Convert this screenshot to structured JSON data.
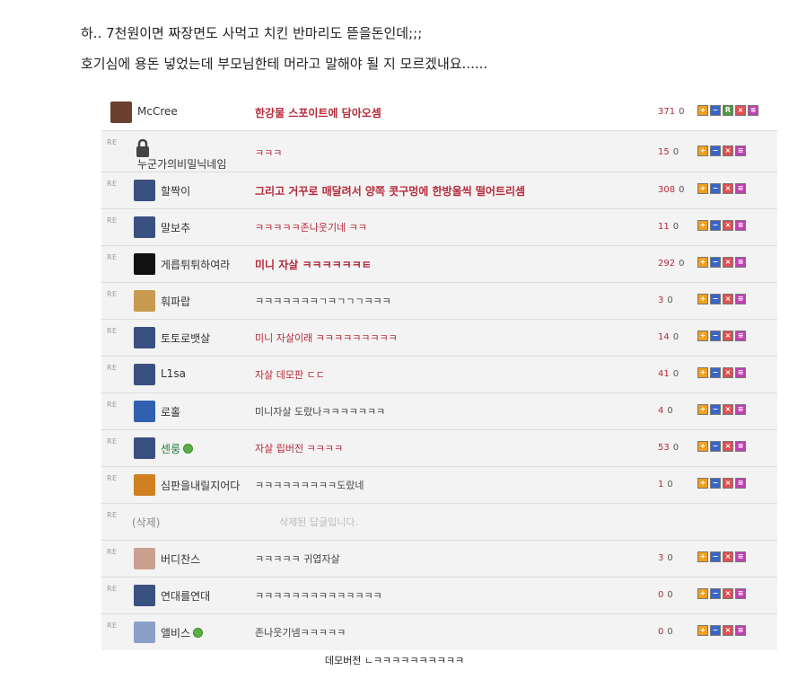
{
  "post": {
    "line1": "하.. 7천원이면 짜장면도 사먹고 치킨 반마리도 뜯을돈인데;;;",
    "line2": "호기심에 용돈 넣었는데 부모님한테 머라고 말해야 될 지 모르겠내요......"
  },
  "re_label": "RE",
  "comments": [
    {
      "nick": "McCree",
      "content": "한강물 스포이트에 담아오셈",
      "rec": "371",
      "zero": "0",
      "avatar_color": "#6b4030"
    },
    {
      "nick": "누군가의비밀닉네임",
      "content": "ㅋㅋㅋ",
      "rec": "15",
      "zero": "0",
      "avatar_color": "#444444"
    },
    {
      "nick": "할짝이",
      "content": "그리고 거꾸로 매달려서 양쪽 콧구멍에 한방울씩 떨어트리셈",
      "rec": "308",
      "zero": "0",
      "avatar_color": "#3a5080"
    },
    {
      "nick": "말보추",
      "content": "ㅋㅋㅋㅋㅋ존나웃기네 ㅋㅋ",
      "rec": "11",
      "zero": "0",
      "avatar_color": "#3a5080"
    },
    {
      "nick": "게릅튀튀하여라",
      "content": "미니 자살 ㅋㅋㅋㅋㅋㅋㅌ",
      "rec": "292",
      "zero": "0",
      "avatar_color": "#111111"
    },
    {
      "nick": "훠파랍",
      "content": "ㅋㅋㅋㅋㅋㅋㅋㄱㅋㄱㄱㄱㅋㅋㅋ",
      "rec": "3",
      "zero": "0",
      "avatar_color": "#c89a50"
    },
    {
      "nick": "토토로뱃살",
      "content": "미니 자살이래 ㅋㅋㅋㅋㅋㅋㅋㅋㅋ",
      "rec": "14",
      "zero": "0",
      "avatar_color": "#3a5080"
    },
    {
      "nick": "L1sa",
      "content": "자살 데모판 ㄷㄷ",
      "rec": "41",
      "zero": "0",
      "avatar_color": "#3a5080"
    },
    {
      "nick": "로홀",
      "content": "미니자살 도랐나ㅋㅋㅋㅋㅋㅋㅋ",
      "rec": "4",
      "zero": "0",
      "avatar_color": "#3060b0"
    },
    {
      "nick": "센룽",
      "content": "자살 립버전 ㅋㅋㅋㅋ",
      "rec": "53",
      "zero": "0",
      "avatar_color": "#3a5080"
    },
    {
      "nick": "심판을내릴지어다",
      "content": "ㅋㅋㅋㅋㅋㅋㅋㅋㅋ도랐네",
      "rec": "1",
      "zero": "0",
      "avatar_color": "#d08020"
    },
    {
      "nick": "(삭제)",
      "content": "삭제된 답글입니다.",
      "rec": "",
      "zero": "",
      "avatar_color": ""
    },
    {
      "nick": "버디찬스",
      "content": "ㅋㅋㅋㅋㅋ 귀엽자살",
      "rec": "3",
      "zero": "0",
      "avatar_color": "#c8a090"
    },
    {
      "nick": "연대를연대",
      "content": "ㅋㅋㅋㅋㅋㅋㅋㅋㅋㅋㅋㅋㅋㅋ",
      "rec": "0",
      "zero": "0",
      "avatar_color": "#3a5080"
    },
    {
      "nick": "앨비스",
      "content": "존나웃기넴ㅋㅋㅋㅋㅋ",
      "rec": "0",
      "zero": "0",
      "avatar_color": "#8aa0c8"
    }
  ],
  "footer_text": "데모버전 ㄴㅋㅋㅋㅋㅋㅋㅋㅋㅋㅋ"
}
